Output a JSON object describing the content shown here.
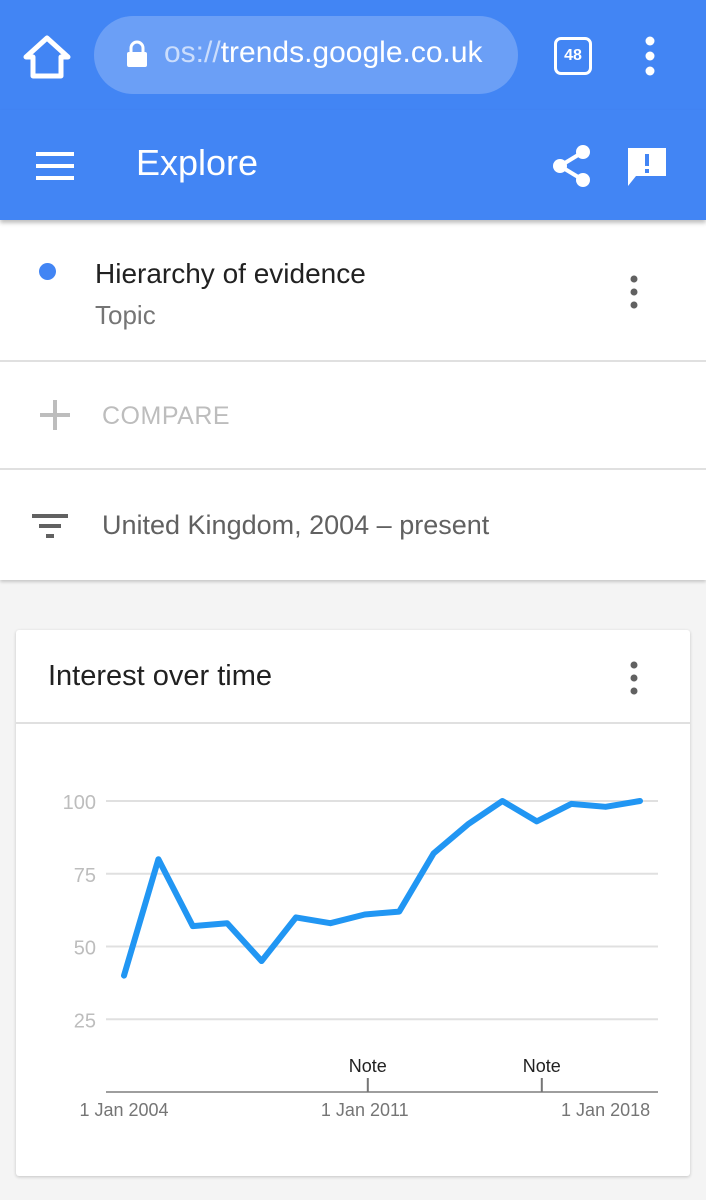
{
  "browser": {
    "url_scheme": "os://",
    "url_host": "trends.google.co.uk",
    "tab_count": "48"
  },
  "app_bar": {
    "title": "Explore"
  },
  "term": {
    "name": "Hierarchy of evidence",
    "type": "Topic",
    "color": "#4285f4"
  },
  "compare": {
    "label": "COMPARE"
  },
  "filter": {
    "text": "United Kingdom, 2004 – present"
  },
  "card": {
    "title": "Interest over time"
  },
  "colors": {
    "accent": "#4285f4",
    "series": "#2196f3"
  },
  "chart_data": {
    "type": "line",
    "x_tick_labels": [
      "1 Jan 2004",
      "1 Jan 2011",
      "1 Jan 2018"
    ],
    "y_ticks": [
      25,
      50,
      75,
      100
    ],
    "ylim": [
      0,
      100
    ],
    "grid": true,
    "notes": [
      {
        "label": "Note",
        "year": 2011
      },
      {
        "label": "Note",
        "year": 2016
      }
    ],
    "x": [
      2004,
      2005,
      2006,
      2007,
      2008,
      2009,
      2010,
      2011,
      2012,
      2013,
      2014,
      2015,
      2016,
      2017,
      2018,
      2019
    ],
    "series": [
      {
        "values": [
          40,
          80,
          57,
          58,
          45,
          60,
          58,
          61,
          62,
          82,
          92,
          100,
          93,
          99,
          98,
          100
        ]
      }
    ]
  }
}
